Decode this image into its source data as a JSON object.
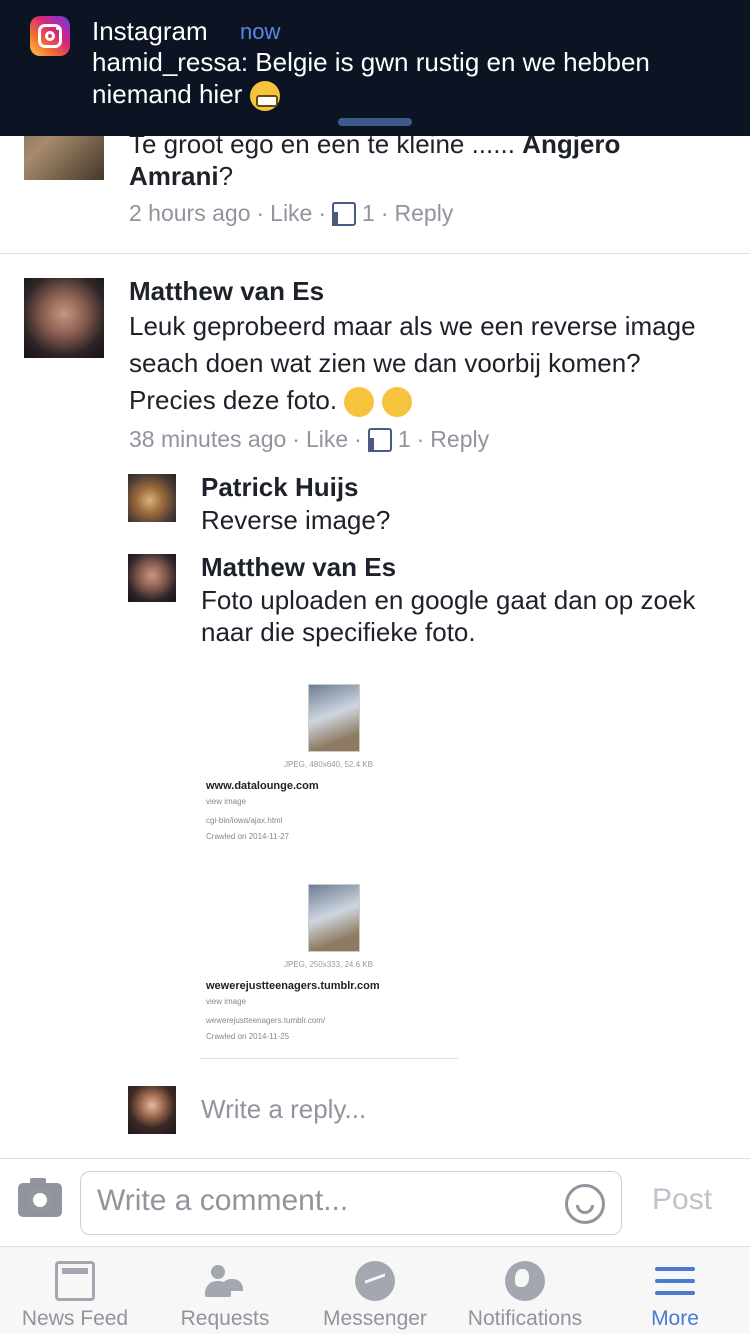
{
  "notification": {
    "app": "Instagram",
    "time": "now",
    "message": "hamid_ressa: Belgie is gwn rustig en we hebben niemand hier"
  },
  "comments": [
    {
      "text_tail": "Te groot ego en een te kleine ......",
      "tag": "Angjero Amrani",
      "tag_suffix": "?",
      "time": "2 hours ago",
      "like": "Like",
      "likes": "1",
      "reply": "Reply"
    },
    {
      "author": "Matthew van Es",
      "text": "Leuk geprobeerd maar als we een reverse image seach doen wat zien we dan voorbij komen?Precies deze foto.",
      "time": "38 minutes ago",
      "like": "Like",
      "likes": "1",
      "reply": "Reply",
      "replies": [
        {
          "author": "Patrick Huijs",
          "text": "Reverse image?"
        },
        {
          "author": "Matthew van Es",
          "text": "Foto uploaden en google gaat dan op zoek naar die specifieke foto."
        }
      ]
    }
  ],
  "search_results": [
    {
      "meta": "JPEG, 480x640, 52.4 KB",
      "site": "www.datalounge.com",
      "view": "view image",
      "path": "cgi-bin/iowa/ajax.html",
      "crawled": "Crawled on 2014-11-27"
    },
    {
      "meta": "JPEG, 250x333, 24.6 KB",
      "site": "wewerejustteenagers.tumblr.com",
      "view": "view image",
      "path": "wewerejustteenagers.tumblr.com/",
      "crawled": "Crawled on 2014-11-25"
    }
  ],
  "reply_placeholder": "Write a reply...",
  "comment_bar": {
    "placeholder": "Write a comment...",
    "post": "Post"
  },
  "tabs": [
    {
      "label": "News Feed",
      "icon": "news-feed-icon"
    },
    {
      "label": "Requests",
      "icon": "friend-requests-icon"
    },
    {
      "label": "Messenger",
      "icon": "messenger-icon"
    },
    {
      "label": "Notifications",
      "icon": "globe-icon"
    },
    {
      "label": "More",
      "icon": "menu-icon",
      "active": true
    }
  ],
  "colors": {
    "accent": "#4b7bd1",
    "muted": "#90949c",
    "banner": "#0c1424"
  }
}
